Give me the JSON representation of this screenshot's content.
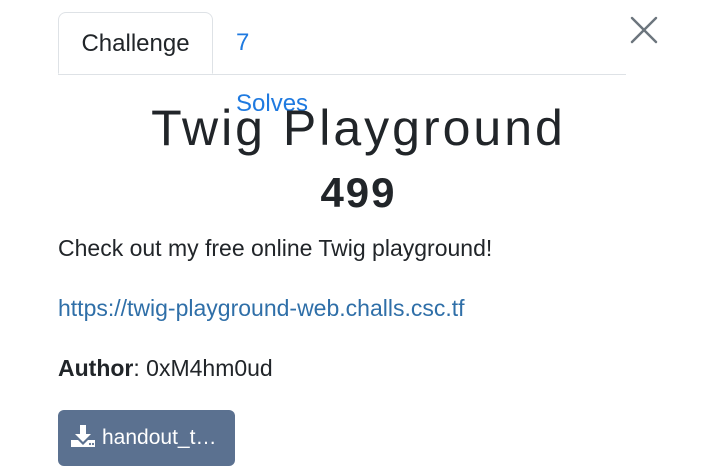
{
  "tabs": {
    "challenge": "Challenge",
    "solves": "7 Solves"
  },
  "challenge": {
    "name": "Twig Playground",
    "points": "499",
    "description": "Check out my free online Twig playground!",
    "url": "https://twig-playground-web.challs.csc.tf",
    "author_label": "Author",
    "author_separator": ": ",
    "author_name": "0xM4hm0ud"
  },
  "download": {
    "icon": "download-icon",
    "filename": "handout_twig-playground.zip"
  },
  "colors": {
    "link": "#1f7ae0",
    "button": "#5b7190",
    "text": "#212529"
  }
}
